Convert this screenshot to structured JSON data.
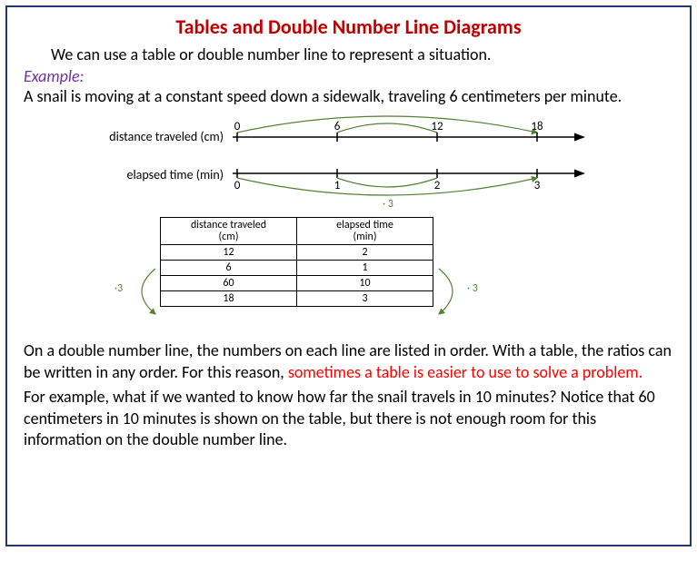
{
  "title": "Tables and Double Number Line Diagrams",
  "intro": "We can use a table or double number line to represent a situation.",
  "example_label": "Example:",
  "example_text": "A snail is moving at a constant speed down a sidewalk, traveling 6 centimeters per minute.",
  "numberlines": {
    "distance_label": "distance traveled (cm)",
    "time_label": "elapsed time (min)",
    "distance_ticks": [
      "0",
      "6",
      "12",
      "18"
    ],
    "time_ticks": [
      "0",
      "1",
      "2",
      "3"
    ],
    "top_arc_mult": "",
    "bottom_arc_mult": "· 3"
  },
  "table": {
    "headers": [
      "distance traveled\n(cm)",
      "elapsed time\n(min)"
    ],
    "rows": [
      [
        "12",
        "2"
      ],
      [
        "6",
        "1"
      ],
      [
        "60",
        "10"
      ],
      [
        "18",
        "3"
      ]
    ],
    "left_mult": "·3",
    "right_mult": "· 3"
  },
  "bottom": {
    "part1": "On a double number line, the numbers on each line are listed in order. With a table, the ratios can be written in any order. For this reason, ",
    "red": "sometimes a table is easier to use to solve a problem.",
    "part2": "For example, what if we wanted to know how far the snail travels in 10 minutes? Notice that 60 centimeters in 10 minutes is shown on the table, but there is not enough room for this information on the double number line."
  },
  "chart_data": {
    "type": "table",
    "title": "Double number line and ratio table: snail speed 6 cm per minute",
    "numberline_distance_cm": [
      0,
      6,
      12,
      18
    ],
    "numberline_time_min": [
      0,
      1,
      2,
      3
    ],
    "table_rows": [
      {
        "distance_cm": 12,
        "time_min": 2
      },
      {
        "distance_cm": 6,
        "time_min": 1
      },
      {
        "distance_cm": 60,
        "time_min": 10
      },
      {
        "distance_cm": 18,
        "time_min": 3
      }
    ],
    "multiplier_shown": 3
  }
}
